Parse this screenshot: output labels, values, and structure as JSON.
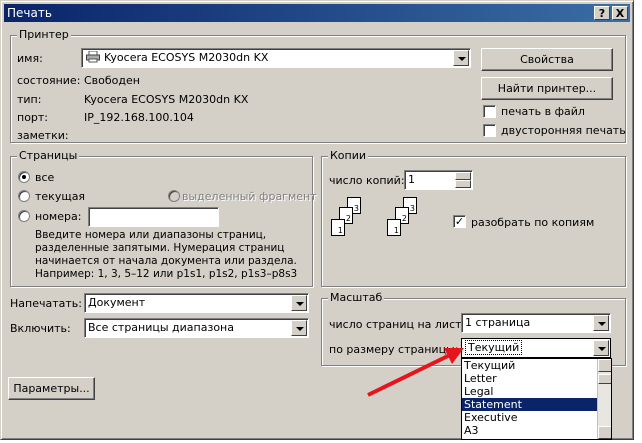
{
  "window": {
    "title": "Печать",
    "help_button": "?",
    "close_button": "X"
  },
  "printer": {
    "group_title": "Принтер",
    "name_label": "имя:",
    "name_value": "Kyocera ECOSYS M2030dn KX",
    "status_label": "состояние:",
    "status_value": "Свободен",
    "type_label": "тип:",
    "type_value": "Kyocera ECOSYS M2030dn KX",
    "port_label": "порт:",
    "port_value": "IP_192.168.100.104",
    "notes_label": "заметки:",
    "properties_button": "Свойства",
    "find_printer_button": "Найти принтер...",
    "print_to_file_label": "печать в файл",
    "duplex_label": "двусторонняя печать"
  },
  "pages": {
    "group_title": "Страницы",
    "all_label": "все",
    "current_label": "текущая",
    "selection_label": "выделенный фрагмент",
    "numbers_label": "номера:",
    "numbers_value": "",
    "hint": "Введите номера или диапазоны страниц, разделенные запятыми. Нумерация страниц начинается от начала документа или раздела. Например: 1, 3, 5–12 или p1s1, p1s2, p1s3–p8s3"
  },
  "copies": {
    "group_title": "Копии",
    "count_label": "число копий:",
    "count_value": "1",
    "collate_label": "разобрать по копиям",
    "collate_checked": true,
    "page_numbers": [
      "1",
      "2",
      "3"
    ]
  },
  "print_what": {
    "label": "Напечатать:",
    "value": "Документ"
  },
  "include": {
    "label": "Включить:",
    "value": "Все страницы диапазона"
  },
  "scale": {
    "group_title": "Масштаб",
    "pages_per_sheet_label": "число страниц на листе:",
    "pages_per_sheet_value": "1 страница",
    "scale_to_paper_label": "по размеру страницы:",
    "scale_to_paper_value": "Текущий",
    "paper_options": [
      "Текущий",
      "Letter",
      "Legal",
      "Statement",
      "Executive",
      "A3"
    ],
    "selected_option": "Statement"
  },
  "params_button": "Параметры...",
  "annotation": {
    "arrow_color": "#e8141c"
  }
}
